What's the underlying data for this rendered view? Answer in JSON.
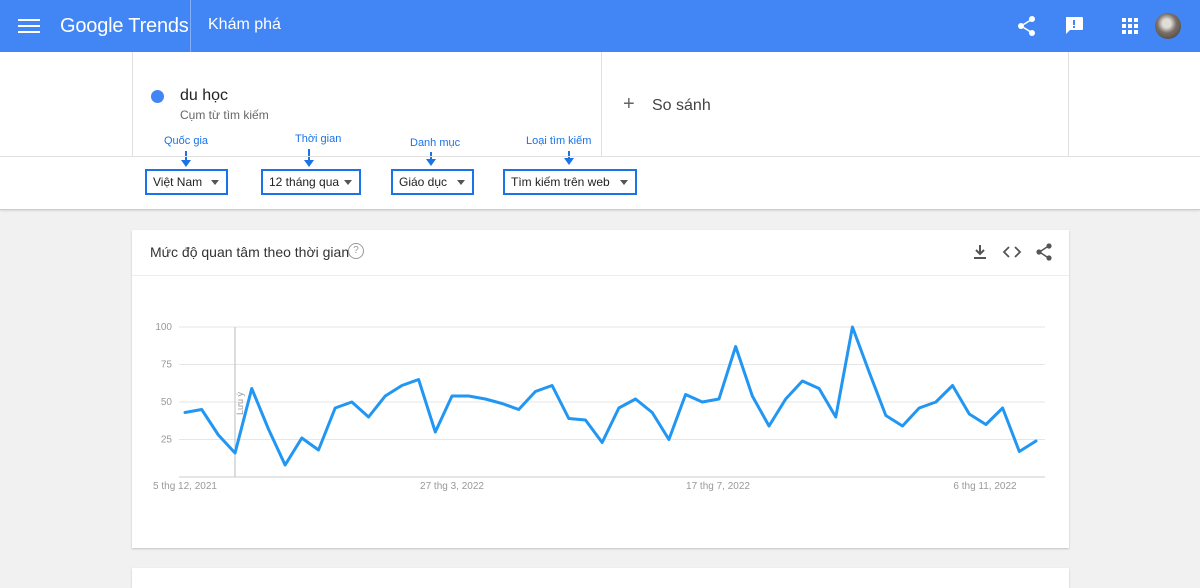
{
  "header": {
    "logo_google": "Google",
    "logo_trends": "Trends",
    "page_title": "Khám phá",
    "icons": [
      "menu-icon",
      "share-icon",
      "feedback-icon",
      "apps-icon",
      "avatar"
    ]
  },
  "search": {
    "term": "du học",
    "term_type": "Cụm từ tìm kiếm",
    "term_color": "#4285f4",
    "compare_label": "So sánh"
  },
  "annotations": {
    "country": "Quốc gia",
    "time": "Thời gian",
    "category": "Danh mục",
    "search_type": "Loại tìm kiếm"
  },
  "filters": {
    "country": "Việt Nam",
    "time": "12 tháng qua",
    "category": "Giáo dục",
    "search_type": "Tìm kiếm trên web"
  },
  "card": {
    "title": "Mức độ quan tâm theo thời gian",
    "help_icon": "?",
    "icons": [
      "download-icon",
      "embed-icon",
      "share-icon"
    ]
  },
  "chart_data": {
    "type": "line",
    "title": "Mức độ quan tâm theo thời gian",
    "ylim": [
      0,
      100
    ],
    "yticks": [
      "100",
      "75",
      "50",
      "25"
    ],
    "xticks": [
      "5 thg 12, 2021",
      "27 thg 3, 2022",
      "17 thg 7, 2022",
      "6 thg 11, 2022"
    ],
    "note_label": "Lưu ý",
    "grid": true,
    "series": [
      {
        "color": "#2196f3",
        "values": [
          43,
          45,
          28,
          16,
          59,
          32,
          8,
          26,
          18,
          46,
          50,
          40,
          54,
          61,
          65,
          30,
          54,
          54,
          52,
          49,
          45,
          57,
          61,
          39,
          38,
          23,
          46,
          52,
          43,
          25,
          55,
          50,
          52,
          87,
          54,
          34,
          52,
          64,
          59,
          40,
          100,
          70,
          41,
          34,
          46,
          50,
          61,
          42,
          35,
          46,
          17,
          24
        ]
      }
    ]
  }
}
